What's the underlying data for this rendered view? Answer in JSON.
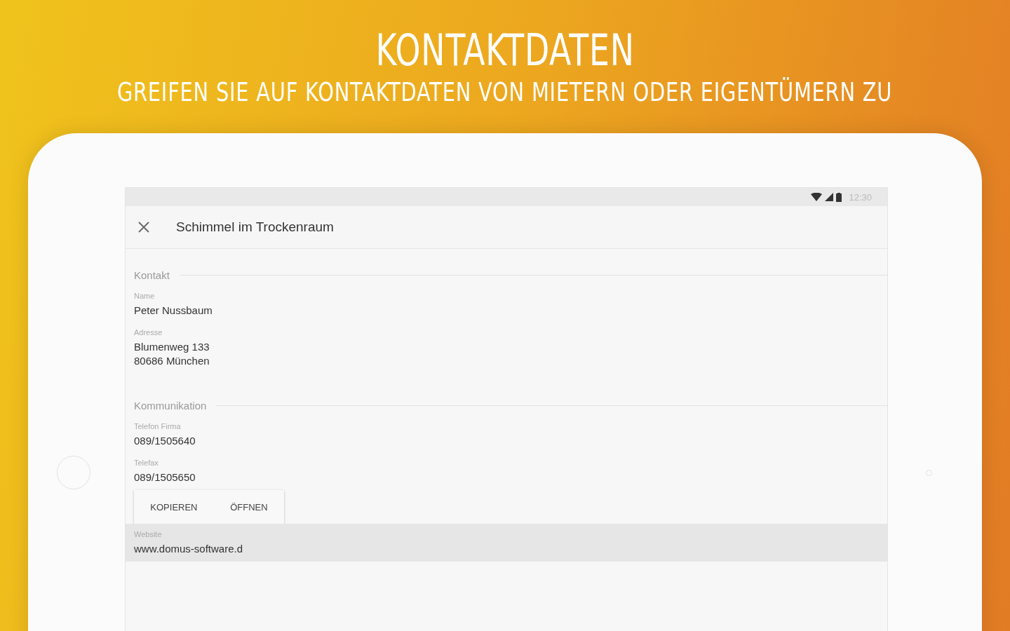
{
  "banner": {
    "title": "KONTAKTDATEN",
    "subtitle": "GREIFEN SIE AUF KONTAKTDATEN VON MIETERN ODER EIGENTÜMERN ZU"
  },
  "status_bar": {
    "time": "12:30"
  },
  "app_bar": {
    "title": "Schimmel im Trockenraum"
  },
  "sections": [
    {
      "title": "Kontakt",
      "fields": [
        {
          "label": "Name",
          "lines": [
            "Peter Nussbaum"
          ],
          "selected": false
        },
        {
          "label": "Adresse",
          "lines": [
            "Blumenweg 133",
            "80686 München"
          ],
          "selected": false
        }
      ]
    },
    {
      "title": "Kommunikation",
      "fields": [
        {
          "label": "Telefon Firma",
          "lines": [
            "089/1505640"
          ],
          "selected": false
        },
        {
          "label": "Telefax",
          "lines": [
            "089/1505650"
          ],
          "selected": false,
          "menu": [
            "KOPIEREN",
            "ÖFFNEN"
          ]
        },
        {
          "label": "Website",
          "lines": [
            "www.domus-software.d"
          ],
          "selected": true
        }
      ]
    }
  ]
}
